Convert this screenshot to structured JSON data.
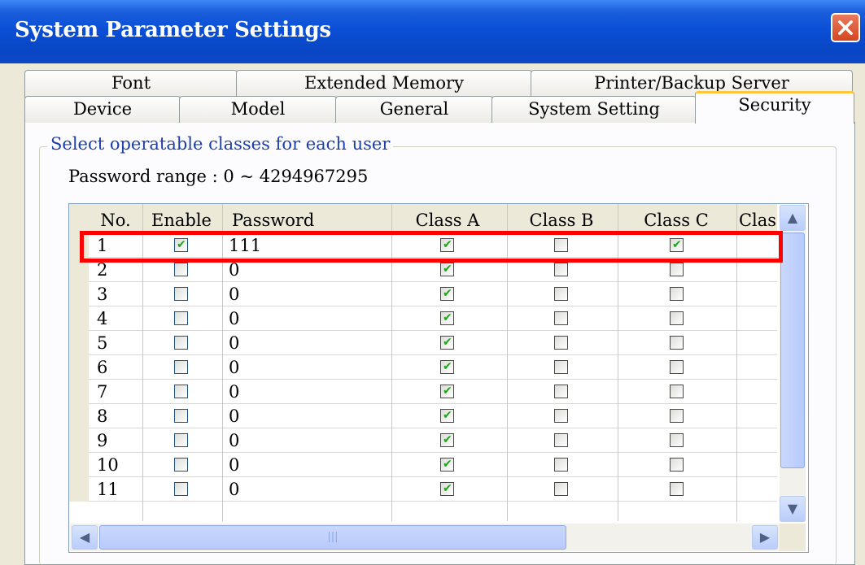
{
  "window": {
    "title": "System Parameter Settings"
  },
  "tabs_back": [
    "Font",
    "Extended Memory",
    "Printer/Backup Server"
  ],
  "tabs_front": [
    "Device",
    "Model",
    "General",
    "System Setting",
    "Security"
  ],
  "active_tab": "Security",
  "group": {
    "legend": "Select operatable classes for each user",
    "password_range": "Password range : 0 ~ 4294967295"
  },
  "table": {
    "columns": [
      "No.",
      "Enable",
      "Password",
      "Class A",
      "Class B",
      "Class C",
      "Clas"
    ],
    "rows": [
      {
        "no": "1",
        "enable": true,
        "password": "111",
        "class_a": true,
        "class_b": false,
        "class_c": true
      },
      {
        "no": "2",
        "enable": false,
        "password": "0",
        "class_a": true,
        "class_b": false,
        "class_c": false
      },
      {
        "no": "3",
        "enable": false,
        "password": "0",
        "class_a": true,
        "class_b": false,
        "class_c": false
      },
      {
        "no": "4",
        "enable": false,
        "password": "0",
        "class_a": true,
        "class_b": false,
        "class_c": false
      },
      {
        "no": "5",
        "enable": false,
        "password": "0",
        "class_a": true,
        "class_b": false,
        "class_c": false
      },
      {
        "no": "6",
        "enable": false,
        "password": "0",
        "class_a": true,
        "class_b": false,
        "class_c": false
      },
      {
        "no": "7",
        "enable": false,
        "password": "0",
        "class_a": true,
        "class_b": false,
        "class_c": false
      },
      {
        "no": "8",
        "enable": false,
        "password": "0",
        "class_a": true,
        "class_b": false,
        "class_c": false
      },
      {
        "no": "9",
        "enable": false,
        "password": "0",
        "class_a": true,
        "class_b": false,
        "class_c": false
      },
      {
        "no": "10",
        "enable": false,
        "password": "0",
        "class_a": true,
        "class_b": false,
        "class_c": false
      },
      {
        "no": "11",
        "enable": false,
        "password": "0",
        "class_a": true,
        "class_b": false,
        "class_c": false
      }
    ]
  },
  "icons": {
    "close": "close-icon",
    "scroll_up": "chevron-up-icon",
    "scroll_down": "chevron-down-icon",
    "scroll_left": "chevron-left-icon",
    "scroll_right": "chevron-right-icon",
    "check": "checkmark-icon"
  },
  "colors": {
    "titlebar": "#0a4fd6",
    "highlight": "#ff0000",
    "check": "#21a121",
    "active_tab_accent": "#ffc83c"
  }
}
